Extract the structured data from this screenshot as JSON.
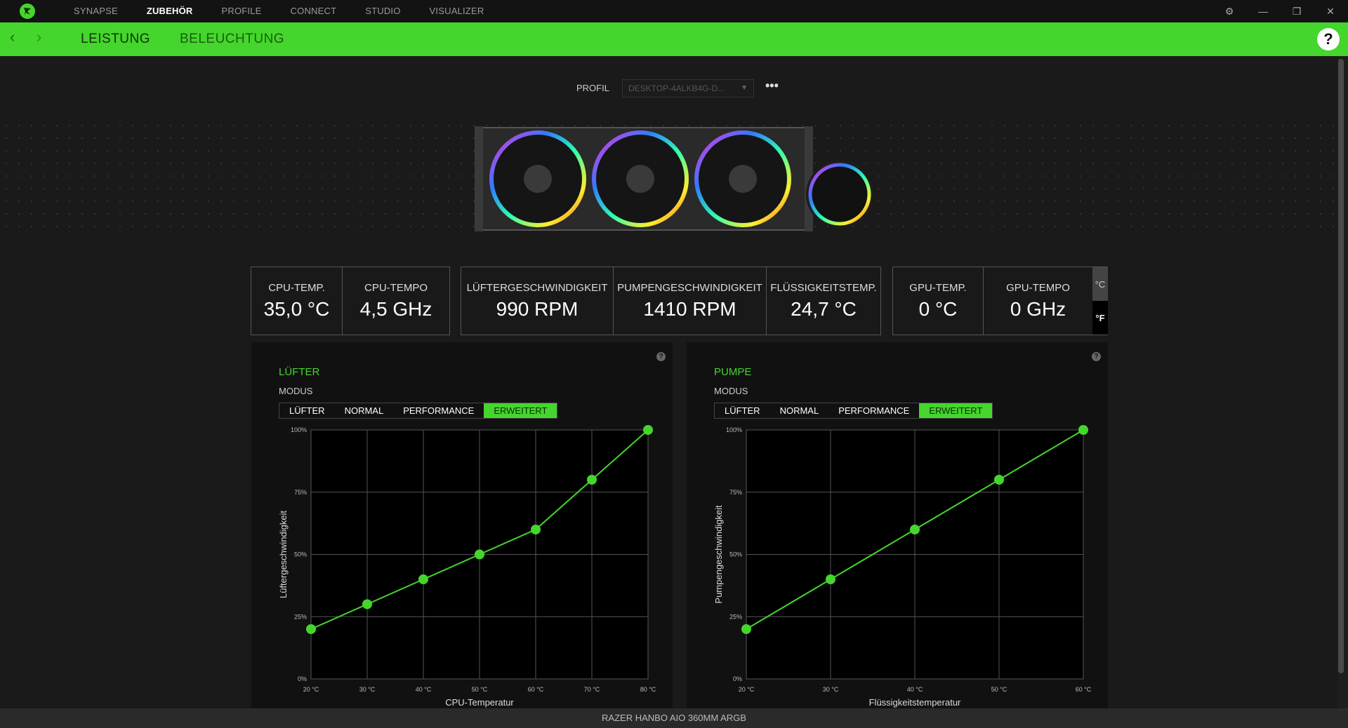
{
  "app": {
    "top_tabs": [
      "SYNAPSE",
      "ZUBEHÖR",
      "PROFILE",
      "CONNECT",
      "STUDIO",
      "VISUALIZER"
    ],
    "active_top_tab": "ZUBEHÖR",
    "accent": "#44d62c"
  },
  "subnav": {
    "tabs": [
      "LEISTUNG",
      "BELEUCHTUNG"
    ],
    "active": "LEISTUNG",
    "help": "?"
  },
  "profile": {
    "label": "PROFIL",
    "value": "DESKTOP-4ALKB4G-D...",
    "more": "•••"
  },
  "stats": {
    "cpu": [
      {
        "label": "CPU-TEMP.",
        "value": "35,0 °C"
      },
      {
        "label": "CPU-TEMPO",
        "value": "4,5 GHz"
      }
    ],
    "cooler": [
      {
        "label": "LÜFTERGESCHWINDIGKEIT",
        "value": "990 RPM"
      },
      {
        "label": "PUMPENGESCHWINDIGKEIT",
        "value": "1410 RPM"
      },
      {
        "label": "FLÜSSIGKEITSTEMP.",
        "value": "24,7 °C"
      }
    ],
    "gpu": [
      {
        "label": "GPU-TEMP.",
        "value": "0 °C"
      },
      {
        "label": "GPU-TEMPO",
        "value": "0 GHz"
      }
    ],
    "units": [
      "°C",
      "°F"
    ],
    "active_unit": "°F"
  },
  "fan_panel": {
    "title": "LÜFTER",
    "mode_label": "MODUS",
    "modes": [
      "LÜFTER",
      "NORMAL",
      "PERFORMANCE",
      "ERWEITERT"
    ],
    "active_mode": "ERWEITERT",
    "help": "?"
  },
  "pump_panel": {
    "title": "PUMPE",
    "mode_label": "MODUS",
    "modes": [
      "LÜFTER",
      "NORMAL",
      "PERFORMANCE",
      "ERWEITERT"
    ],
    "active_mode": "ERWEITERT",
    "help": "?"
  },
  "chart_data": [
    {
      "type": "line",
      "xlabel": "CPU-Temperatur",
      "ylabel": "Lüftergeschwindigkeit",
      "x_ticks": [
        "20 °C",
        "30 °C",
        "40 °C",
        "50 °C",
        "60 °C",
        "70 °C",
        "80 °C"
      ],
      "y_ticks": [
        "0%",
        "25%",
        "50%",
        "75%",
        "100%"
      ],
      "xlim": [
        20,
        80
      ],
      "ylim": [
        0,
        100
      ],
      "grid": true,
      "series": [
        {
          "x": [
            20,
            30,
            40,
            50,
            60,
            70,
            80
          ],
          "y": [
            20,
            30,
            40,
            50,
            60,
            80,
            100
          ]
        }
      ]
    },
    {
      "type": "line",
      "xlabel": "Flüssigkeitstemperatur",
      "ylabel": "Pumpengeschwindigkeit",
      "x_ticks": [
        "20 °C",
        "30 °C",
        "40 °C",
        "50 °C",
        "60 °C"
      ],
      "y_ticks": [
        "0%",
        "25%",
        "50%",
        "75%",
        "100%"
      ],
      "xlim": [
        20,
        60
      ],
      "ylim": [
        0,
        100
      ],
      "grid": true,
      "series": [
        {
          "x": [
            20,
            30,
            40,
            50,
            60
          ],
          "y": [
            20,
            40,
            60,
            80,
            100
          ]
        }
      ]
    }
  ],
  "status": {
    "device_name": "RAZER HANBO AIO 360MM ARGB"
  }
}
